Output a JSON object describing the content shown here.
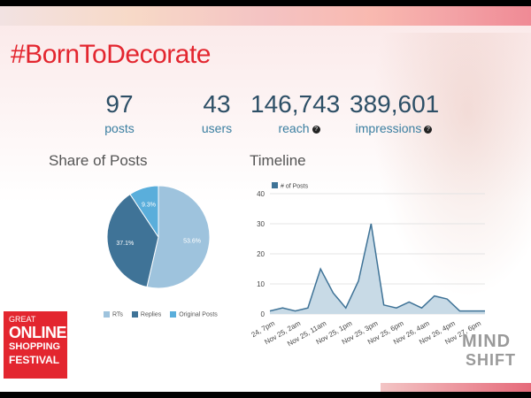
{
  "header": {
    "hashtag": "#BornToDecorate"
  },
  "stats": [
    {
      "value": "97",
      "label": "posts"
    },
    {
      "value": "43",
      "label": "users"
    },
    {
      "value": "146,743",
      "label": "reach"
    },
    {
      "value": "389,601",
      "label": "impressions"
    }
  ],
  "logos": {
    "festival": {
      "line1": "GREAT",
      "line2": "ONLINE",
      "line3": "SHOPPING",
      "line4": "FESTIVAL"
    },
    "mindshift": {
      "line1": "MIND",
      "line2": "SHIFT"
    }
  },
  "chart_data": [
    {
      "type": "pie",
      "title": "Share of Posts",
      "slices": [
        {
          "label": "RTs",
          "value": 53.6,
          "display": "53.6%",
          "color": "#9ec3dd"
        },
        {
          "label": "Replies",
          "value": 37.1,
          "display": "37.1%",
          "color": "#3f7397"
        },
        {
          "label": "Original Posts",
          "value": 9.3,
          "display": "9.3%",
          "color": "#5aaedb"
        }
      ],
      "legend": "bottom"
    },
    {
      "type": "area",
      "title": "Timeline",
      "series": [
        {
          "name": "# of Posts",
          "color": "#3f7397",
          "fill": "#c8dae6",
          "values": [
            1,
            2,
            1,
            2,
            15,
            7,
            2,
            11,
            30,
            3,
            2,
            4,
            2,
            6,
            5,
            1,
            1,
            1
          ]
        }
      ],
      "x_tick_labels": [
        "24, 7pm",
        "Nov 25, 2am",
        "Nov 25, 11am",
        "Nov 25, 1pm",
        "Nov 25, 3pm",
        "Nov 25, 6pm",
        "Nov 26, 4am",
        "Nov 26, 4pm",
        "Nov 27, 6pm"
      ],
      "ylim": [
        0,
        40
      ],
      "y_ticks": [
        0,
        10,
        20,
        30,
        40
      ],
      "grid": true,
      "legend": "top-left"
    }
  ]
}
